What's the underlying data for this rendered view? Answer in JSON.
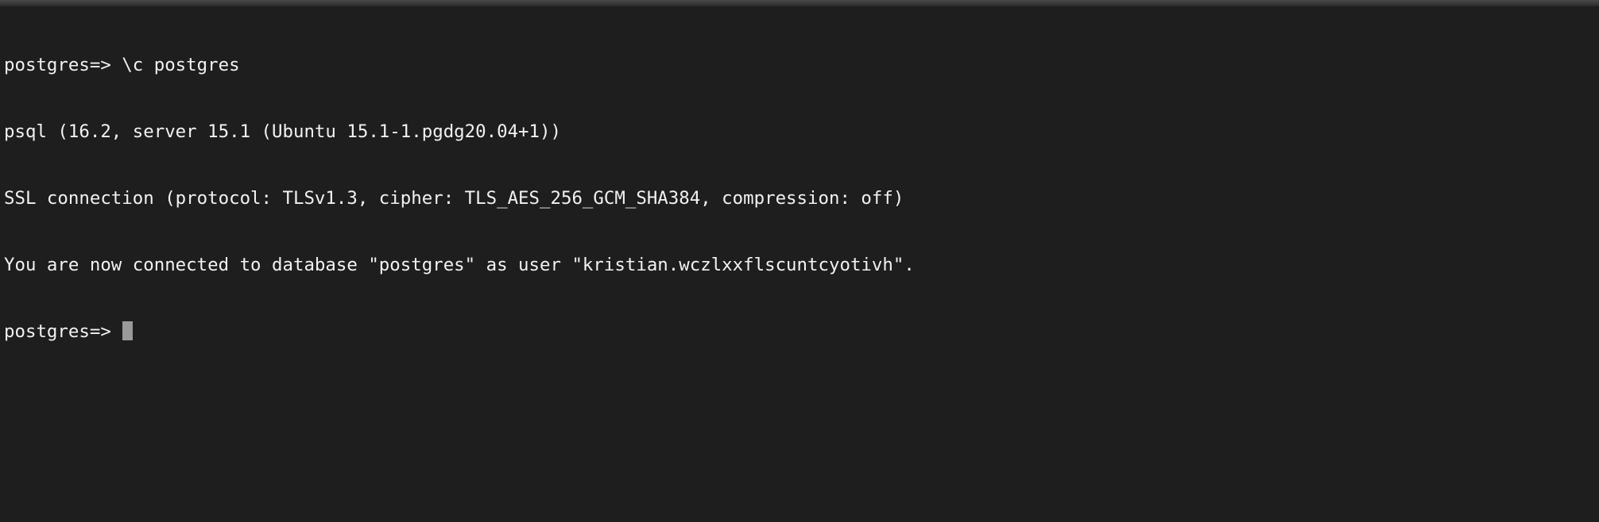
{
  "terminal": {
    "lines": [
      "postgres=> \\c postgres",
      "psql (16.2, server 15.1 (Ubuntu 15.1-1.pgdg20.04+1))",
      "SSL connection (protocol: TLSv1.3, cipher: TLS_AES_256_GCM_SHA384, compression: off)",
      "You are now connected to database \"postgres\" as user \"kristian.wczlxxflscuntcyotivh\"."
    ],
    "prompt": "postgres=>",
    "input_value": ""
  },
  "colors": {
    "background": "#1e1e1e",
    "text": "#f2f2f2",
    "cursor": "#9a9a9a"
  }
}
